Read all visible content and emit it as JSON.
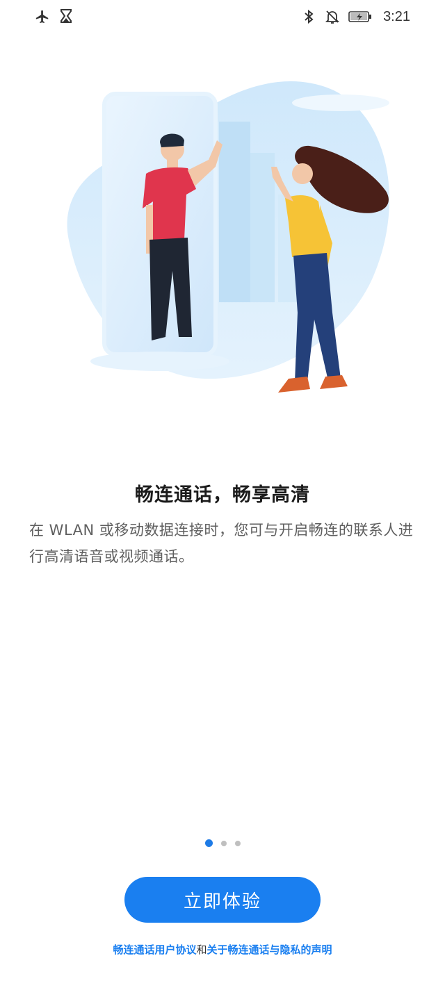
{
  "status_bar": {
    "left_icons": [
      "airplane-icon",
      "hourglass-icon"
    ],
    "right_icons": [
      "bluetooth-icon",
      "bell-off-icon",
      "battery-charging-icon"
    ],
    "time": "3:21"
  },
  "content": {
    "headline": "畅连通话，畅享高清",
    "description": "在 WLAN 或移动数据连接时，您可与开启畅连的联系人进行高清语音或视频通话。"
  },
  "pager": {
    "count": 3,
    "active_index": 0
  },
  "cta": {
    "label": "立即体验"
  },
  "footer": {
    "link_user_agreement": "畅连通话用户协议",
    "connector": "和",
    "link_privacy": "关于畅连通话与隐私的声明"
  },
  "colors": {
    "accent": "#1a7ff0",
    "pager_active": "#1e7be6",
    "pager_inactive": "#bfbfbf"
  }
}
